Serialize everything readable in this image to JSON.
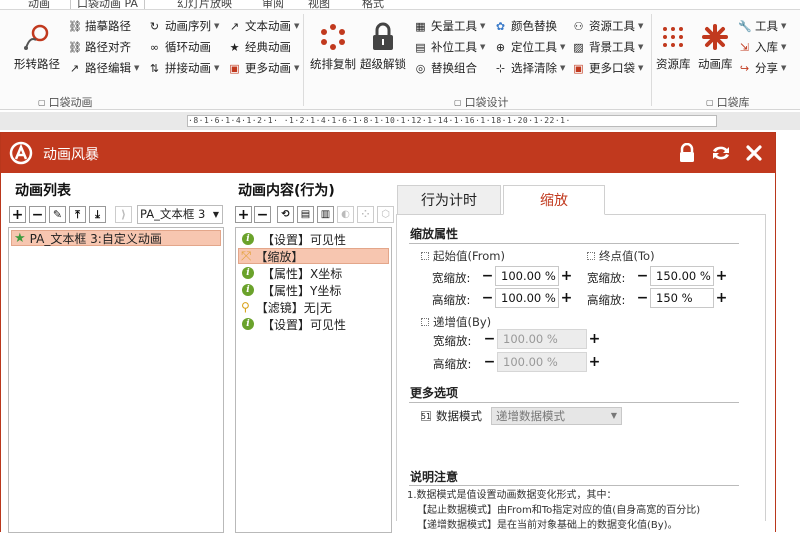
{
  "ribbon_tabs": [
    "动画",
    "口袋动画 PA",
    "幻灯片放映",
    "审阅",
    "视图",
    "格式"
  ],
  "ribbon": {
    "group1": {
      "big_label": "形转路径",
      "items": [
        {
          "label": "描摹路径",
          "icon": "trace-path-icon",
          "dd": false
        },
        {
          "label": "路径对齐",
          "icon": "path-align-icon",
          "dd": false
        },
        {
          "label": "路径编辑",
          "icon": "path-edit-icon",
          "dd": true
        },
        {
          "label": "动画序列",
          "icon": "anim-sequence-icon",
          "dd": true
        },
        {
          "label": "循环动画",
          "icon": "loop-anim-icon",
          "dd": false
        },
        {
          "label": "拼接动画",
          "icon": "splice-anim-icon",
          "dd": true
        },
        {
          "label": "文本动画",
          "icon": "text-anim-icon",
          "dd": true
        },
        {
          "label": "经典动画",
          "icon": "classic-anim-icon",
          "dd": false
        },
        {
          "label": "更多动画",
          "icon": "more-anim-icon",
          "dd": true
        }
      ],
      "label": "口袋动画"
    },
    "group2": {
      "big1": "统排复制",
      "big2": "超级解锁",
      "items": [
        {
          "label": "矢量工具",
          "icon": "vector-tool-icon",
          "dd": true
        },
        {
          "label": "补位工具",
          "icon": "fill-tool-icon",
          "dd": true
        },
        {
          "label": "替换组合",
          "icon": "replace-group-icon",
          "dd": false
        },
        {
          "label": "颜色替换",
          "icon": "color-replace-icon",
          "dd": false
        },
        {
          "label": "定位工具",
          "icon": "locate-tool-icon",
          "dd": true
        },
        {
          "label": "选择清除",
          "icon": "select-clear-icon",
          "dd": true
        },
        {
          "label": "资源工具",
          "icon": "resource-tool-icon",
          "dd": true
        },
        {
          "label": "背景工具",
          "icon": "background-tool-icon",
          "dd": true
        },
        {
          "label": "更多口袋",
          "icon": "more-pocket-icon",
          "dd": true
        }
      ],
      "label": "口袋设计"
    },
    "group3": {
      "big1": "资源库",
      "big2": "动画库",
      "items": [
        {
          "label": "工具",
          "icon": "wrench-icon",
          "dd": true
        },
        {
          "label": "入库",
          "icon": "import-icon",
          "dd": true
        },
        {
          "label": "分享",
          "icon": "share-icon",
          "dd": true
        }
      ],
      "label": "口袋库"
    }
  },
  "ruler_text": "·8·1·6·1·4·1·2·1· ·1·2·1·4·1·6·1·8·1·10·1·12·1·14·1·16·1·18·1·20·1·22·1·",
  "dialog": {
    "title": "动画风暴",
    "anim_list": {
      "heading": "动画列表",
      "selector": "PA_文本框 3",
      "items": [
        {
          "label": "PA_文本框 3:自定义动画",
          "selected": true
        }
      ]
    },
    "anim_content": {
      "heading": "动画内容(行为)",
      "items": [
        {
          "label": "【设置】可见性",
          "icon": "info",
          "selected": false
        },
        {
          "label": "【缩放】",
          "icon": "scale",
          "selected": true
        },
        {
          "label": "【属性】X坐标",
          "icon": "info",
          "selected": false
        },
        {
          "label": "【属性】Y坐标",
          "icon": "info",
          "selected": false
        },
        {
          "label": "【滤镜】无|无",
          "icon": "filter",
          "selected": false
        },
        {
          "label": "【设置】可见性",
          "icon": "info",
          "selected": false
        }
      ]
    },
    "tabs": {
      "timing": "行为计时",
      "scale": "缩放"
    },
    "scale_props": {
      "title": "缩放属性",
      "from_title": "起始值(From)",
      "to_title": "终点值(To)",
      "by_title": "递增值(By)",
      "width_label": "宽缩放:",
      "height_label": "高缩放:",
      "from_width": "100.00 %",
      "from_height": "100.00 %",
      "to_width": "150.00 %",
      "to_height": "150 %",
      "by_width": "100.00 %",
      "by_height": "100.00 %"
    },
    "more_options": {
      "title": "更多选项",
      "mode_label": "数据模式",
      "mode_value": "递增数据模式"
    },
    "notes": {
      "title": "说明注意",
      "lines": [
        "1.数据模式是值设置动画数据变化形式，其中：",
        "【起止数据模式】由From和To指定对应的值(自身高宽的百分比)",
        "【递增数据模式】是在当前对象基础上的数据变化值(By)。"
      ]
    }
  },
  "colors": {
    "accent": "#c1391e",
    "selection": "#f7c6b0"
  }
}
